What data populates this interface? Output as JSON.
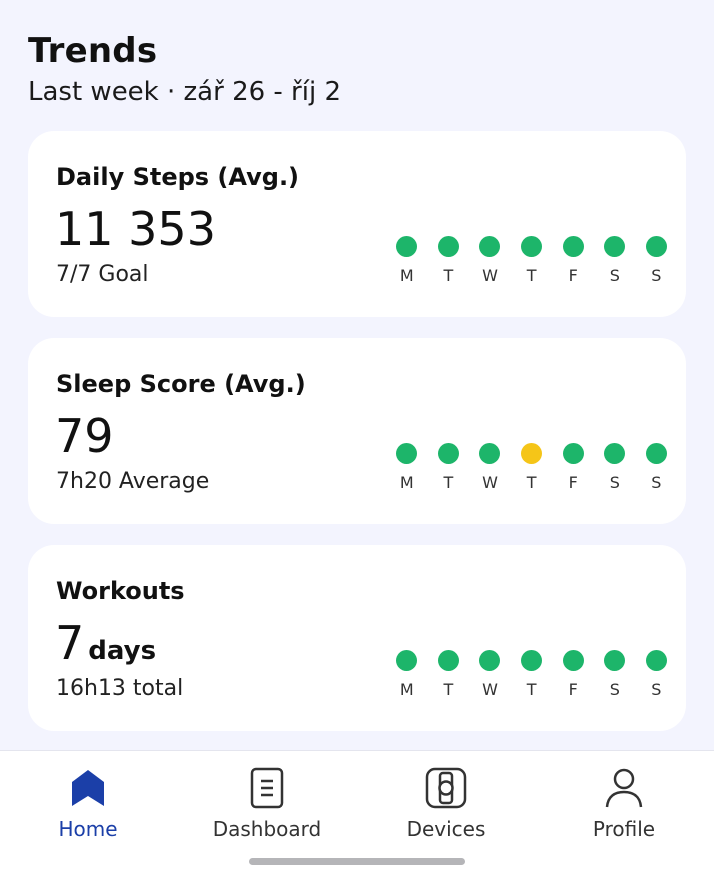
{
  "header": {
    "title": "Trends",
    "subtitle": "Last week · zář 26 - říj 2"
  },
  "cards": [
    {
      "title": "Daily Steps (Avg.)",
      "value": "11 353",
      "unit": "",
      "sub": "7/7 Goal",
      "days": [
        {
          "label": "M",
          "status": "met"
        },
        {
          "label": "T",
          "status": "met"
        },
        {
          "label": "W",
          "status": "met"
        },
        {
          "label": "T",
          "status": "met"
        },
        {
          "label": "F",
          "status": "met"
        },
        {
          "label": "S",
          "status": "met"
        },
        {
          "label": "S",
          "status": "met"
        }
      ]
    },
    {
      "title": "Sleep Score (Avg.)",
      "value": "79",
      "unit": "",
      "sub": "7h20 Average",
      "days": [
        {
          "label": "M",
          "status": "met"
        },
        {
          "label": "T",
          "status": "met"
        },
        {
          "label": "W",
          "status": "met"
        },
        {
          "label": "T",
          "status": "partial"
        },
        {
          "label": "F",
          "status": "met"
        },
        {
          "label": "S",
          "status": "met"
        },
        {
          "label": "S",
          "status": "met"
        }
      ]
    },
    {
      "title": "Workouts",
      "value": "7",
      "unit": "days",
      "sub": "16h13 total",
      "days": [
        {
          "label": "M",
          "status": "met"
        },
        {
          "label": "T",
          "status": "met"
        },
        {
          "label": "W",
          "status": "met"
        },
        {
          "label": "T",
          "status": "met"
        },
        {
          "label": "F",
          "status": "met"
        },
        {
          "label": "S",
          "status": "met"
        },
        {
          "label": "S",
          "status": "met"
        }
      ]
    }
  ],
  "colors": {
    "met": "#1DB56A",
    "partial": "#F5C518",
    "accent": "#1B3FA8",
    "background": "#F3F4FE"
  },
  "nav": [
    {
      "label": "Home",
      "icon": "home-icon",
      "active": true
    },
    {
      "label": "Dashboard",
      "icon": "dashboard-icon",
      "active": false
    },
    {
      "label": "Devices",
      "icon": "watch-icon",
      "active": false
    },
    {
      "label": "Profile",
      "icon": "profile-icon",
      "active": false
    }
  ]
}
